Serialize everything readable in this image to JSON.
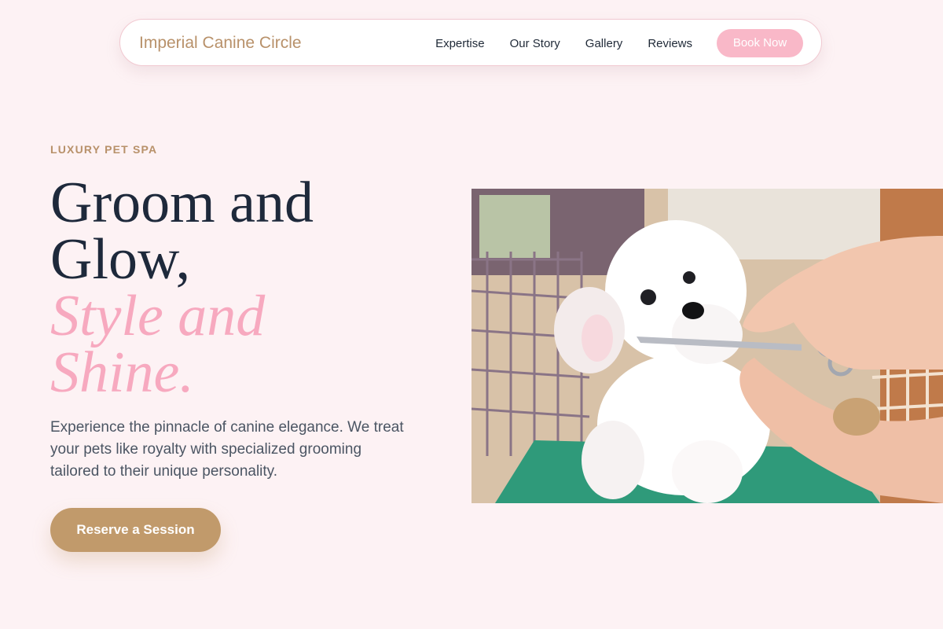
{
  "nav": {
    "brand": "Imperial Canine Circle",
    "links": [
      "Expertise",
      "Our Story",
      "Gallery",
      "Reviews"
    ],
    "cta": "Book Now"
  },
  "hero": {
    "eyebrow": "LUXURY PET SPA",
    "headline_line1": "Groom and",
    "headline_line2": "Glow,",
    "headline_line3": "Style and",
    "headline_line4": "Shine.",
    "description": "Experience the pinnacle of canine elegance. We treat your pets like royalty with specialized grooming tailored to their unique personality.",
    "cta": "Reserve a Session",
    "image_alt": "Groomer trimming a white poodle with scissors"
  },
  "colors": {
    "background": "#fdf2f4",
    "brand_gold": "#b8916a",
    "accent_pink": "#f7a9bf",
    "button_gold": "#c19a6b",
    "text_dark": "#1e293b"
  }
}
